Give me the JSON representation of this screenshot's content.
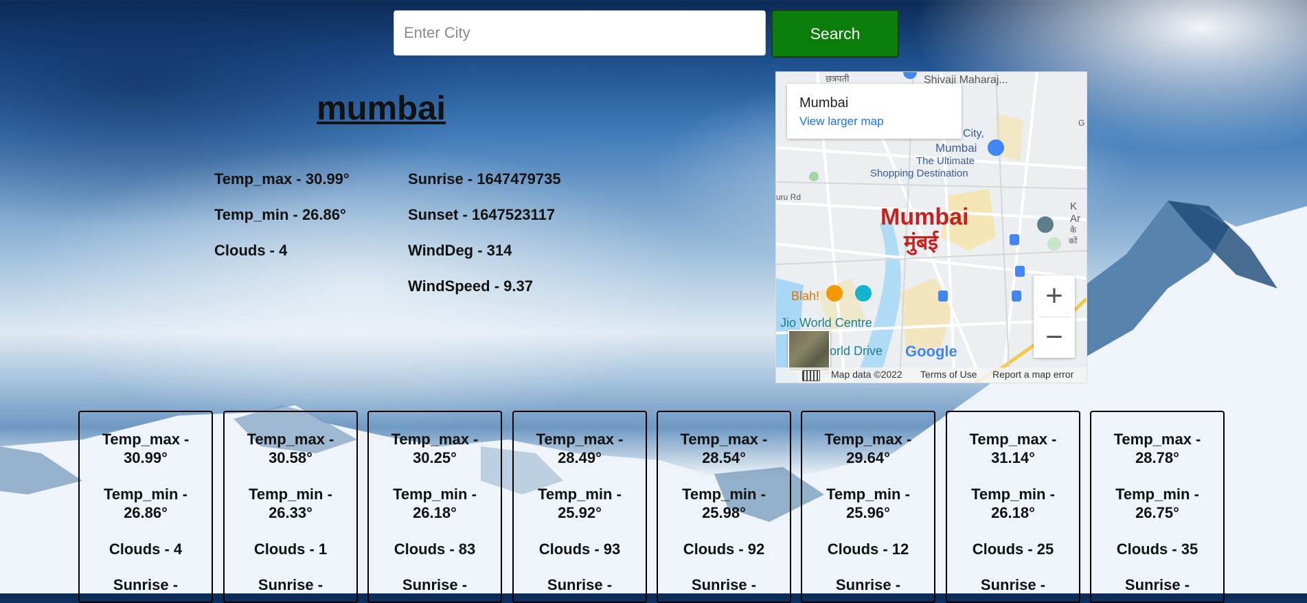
{
  "search": {
    "placeholder": "Enter City",
    "value": "",
    "button_label": "Search"
  },
  "city": {
    "name": "mumbai",
    "left_stats": [
      "Temp_max - 30.99°",
      "Temp_min - 26.86°",
      "Clouds - 4"
    ],
    "right_stats": [
      "Sunrise - 1647479735",
      "Sunset - 1647523117",
      "WindDeg - 314",
      "WindSpeed - 9.37"
    ]
  },
  "map": {
    "card_title": "Mumbai",
    "card_link": "View larger map",
    "zoom_in": "+",
    "zoom_out": "−",
    "labels": {
      "top_left": "छत्रपती",
      "top_right": "Shivaji Maharaj...",
      "city_fragment": "City,",
      "mall_name": "Mumbai",
      "mall_line1": "The Ultimate",
      "mall_line2": "Shopping Destination",
      "road": "uru Rd",
      "big_city_en": "Mumbai",
      "big_city_hi": "मुंबई",
      "blah": "Blah!",
      "jio": "Jio World Centre",
      "drive": "orld Drive",
      "google": "Google",
      "right_ka": "K",
      "right_ar": "Ar",
      "right_ke": "के",
      "right_kon": "कों",
      "right_g": "G"
    },
    "footer": {
      "map_data": "Map data ©2022",
      "terms": "Terms of Use",
      "report": "Report a map error"
    }
  },
  "forecast": [
    {
      "tmax_a": "Temp_max -",
      "tmax_b": "30.99°",
      "tmin_a": "Temp_min -",
      "tmin_b": "26.86°",
      "clouds": "Clouds - 4",
      "sunrise": "Sunrise -"
    },
    {
      "tmax_a": "Temp_max -",
      "tmax_b": "30.58°",
      "tmin_a": "Temp_min -",
      "tmin_b": "26.33°",
      "clouds": "Clouds - 1",
      "sunrise": "Sunrise -"
    },
    {
      "tmax_a": "Temp_max -",
      "tmax_b": "30.25°",
      "tmin_a": "Temp_min -",
      "tmin_b": "26.18°",
      "clouds": "Clouds - 83",
      "sunrise": "Sunrise -"
    },
    {
      "tmax_a": "Temp_max -",
      "tmax_b": "28.49°",
      "tmin_a": "Temp_min -",
      "tmin_b": "25.92°",
      "clouds": "Clouds - 93",
      "sunrise": "Sunrise -"
    },
    {
      "tmax_a": "Temp_max -",
      "tmax_b": "28.54°",
      "tmin_a": "Temp_min -",
      "tmin_b": "25.98°",
      "clouds": "Clouds - 92",
      "sunrise": "Sunrise -"
    },
    {
      "tmax_a": "Temp_max -",
      "tmax_b": "29.64°",
      "tmin_a": "Temp_min -",
      "tmin_b": "25.96°",
      "clouds": "Clouds - 12",
      "sunrise": "Sunrise -"
    },
    {
      "tmax_a": "Temp_max -",
      "tmax_b": "31.14°",
      "tmin_a": "Temp_min -",
      "tmin_b": "26.18°",
      "clouds": "Clouds - 25",
      "sunrise": "Sunrise -"
    },
    {
      "tmax_a": "Temp_max -",
      "tmax_b": "28.78°",
      "tmin_a": "Temp_min -",
      "tmin_b": "26.75°",
      "clouds": "Clouds - 35",
      "sunrise": "Sunrise -"
    }
  ]
}
